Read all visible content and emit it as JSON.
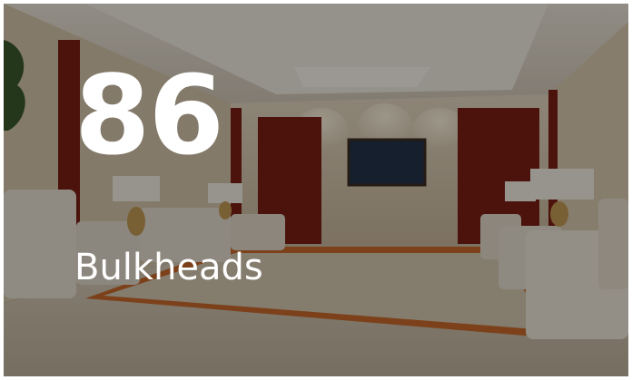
{
  "card": {
    "number": "86",
    "label": "Bulkheads"
  }
}
